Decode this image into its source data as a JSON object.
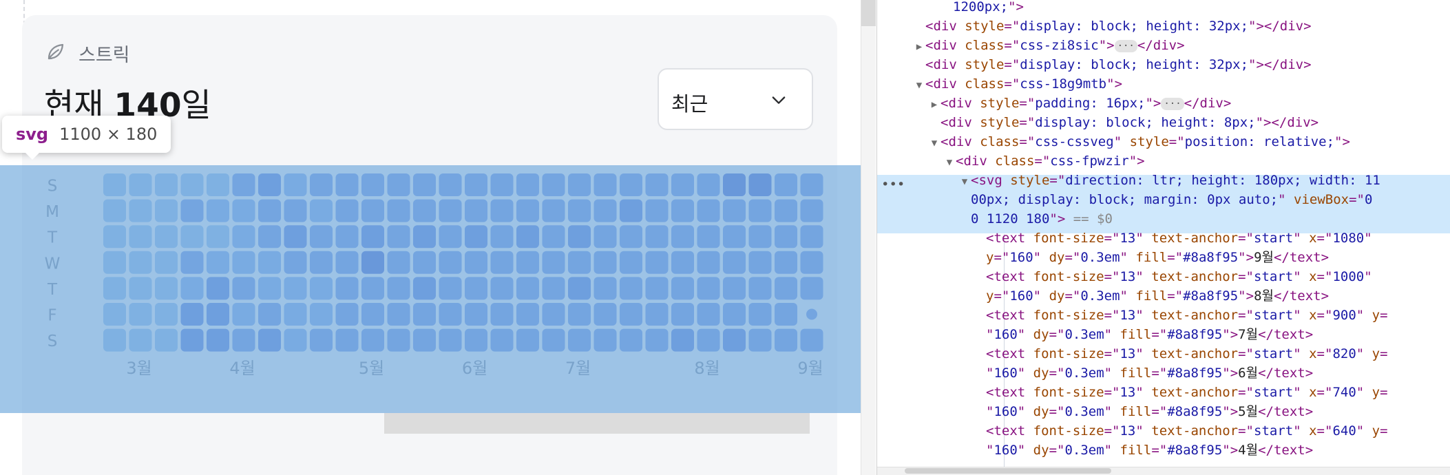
{
  "card": {
    "label": "스트릭",
    "current_prefix": "현재 ",
    "current_value": "140",
    "current_suffix": "일",
    "period_select": "최근"
  },
  "inspector_tooltip": {
    "tag": "svg",
    "size": "1100 × 180"
  },
  "heatmap": {
    "day_labels": [
      "S",
      "M",
      "T",
      "W",
      "T",
      "F",
      "S"
    ],
    "month_labels": [
      "3월",
      "4월",
      "5월",
      "6월",
      "7월",
      "8월",
      "9월"
    ],
    "month_columns": [
      1,
      5,
      10,
      14,
      18,
      23,
      27
    ],
    "colors": [
      "#9ec0ec",
      "#8dafed",
      "#7f9fe8",
      "#6e8de2",
      "#5e79d7"
    ],
    "levels": [
      [
        0,
        0,
        0,
        0,
        0,
        2,
        3,
        1,
        2,
        2,
        2,
        2,
        2,
        2,
        2,
        2,
        2,
        2,
        2,
        2,
        2,
        2,
        2,
        2,
        4,
        4,
        2,
        2
      ],
      [
        0,
        0,
        0,
        2,
        1,
        1,
        2,
        2,
        1,
        2,
        2,
        2,
        2,
        2,
        2,
        2,
        2,
        2,
        2,
        2,
        3,
        2,
        2,
        2,
        2,
        2,
        2,
        2
      ],
      [
        0,
        0,
        0,
        0,
        0,
        1,
        2,
        3,
        2,
        2,
        3,
        2,
        3,
        2,
        3,
        2,
        3,
        2,
        3,
        2,
        2,
        2,
        2,
        2,
        2,
        2,
        2,
        2
      ],
      [
        0,
        0,
        0,
        2,
        1,
        1,
        1,
        2,
        2,
        2,
        4,
        2,
        2,
        2,
        2,
        2,
        2,
        2,
        2,
        2,
        2,
        2,
        2,
        2,
        2,
        2,
        2,
        2
      ],
      [
        0,
        0,
        0,
        1,
        3,
        2,
        1,
        1,
        1,
        2,
        2,
        2,
        3,
        2,
        2,
        2,
        2,
        2,
        3,
        2,
        2,
        2,
        2,
        2,
        2,
        2,
        2,
        2
      ],
      [
        0,
        0,
        0,
        3,
        3,
        1,
        2,
        1,
        1,
        2,
        2,
        2,
        2,
        2,
        2,
        2,
        2,
        2,
        2,
        2,
        2,
        2,
        2,
        2,
        2,
        2,
        2,
        -1
      ],
      [
        0,
        0,
        0,
        3,
        3,
        2,
        3,
        1,
        2,
        2,
        2,
        2,
        2,
        2,
        2,
        2,
        2,
        2,
        2,
        2,
        2,
        2,
        3,
        2,
        3,
        2,
        2,
        2
      ]
    ]
  },
  "devtools": {
    "lines": [
      {
        "indent": 0,
        "tw": "",
        "parts": [
          [
            "val",
            "1200px;"
          ],
          [
            "tag",
            "\">"
          ]
        ]
      },
      {
        "indent": 0,
        "tw": "",
        "parts": [
          [
            "tag",
            "<div "
          ],
          [
            "attr",
            "style"
          ],
          [
            "tag",
            "=\""
          ],
          [
            "val",
            "display: block; height: 32px;"
          ],
          [
            "tag",
            "\"></div>"
          ]
        ]
      },
      {
        "indent": 0,
        "tw": "▶",
        "parts": [
          [
            "tag",
            "<div "
          ],
          [
            "attr",
            "class"
          ],
          [
            "tag",
            "=\""
          ],
          [
            "val",
            "css-zi8sic"
          ],
          [
            "tag",
            "\">"
          ],
          [
            "badge",
            "···"
          ],
          [
            "tag",
            "</div>"
          ]
        ]
      },
      {
        "indent": 0,
        "tw": "",
        "parts": [
          [
            "tag",
            "<div "
          ],
          [
            "attr",
            "style"
          ],
          [
            "tag",
            "=\""
          ],
          [
            "val",
            "display: block; height: 32px;"
          ],
          [
            "tag",
            "\"></div>"
          ]
        ]
      },
      {
        "indent": 0,
        "tw": "▼",
        "parts": [
          [
            "tag",
            "<div "
          ],
          [
            "attr",
            "class"
          ],
          [
            "tag",
            "=\""
          ],
          [
            "val",
            "css-18g9mtb"
          ],
          [
            "tag",
            "\">"
          ]
        ]
      },
      {
        "indent": 1,
        "tw": "▶",
        "parts": [
          [
            "tag",
            "<div "
          ],
          [
            "attr",
            "style"
          ],
          [
            "tag",
            "=\""
          ],
          [
            "val",
            "padding: 16px;"
          ],
          [
            "tag",
            "\">"
          ],
          [
            "badge",
            "···"
          ],
          [
            "tag",
            "</div>"
          ]
        ]
      },
      {
        "indent": 1,
        "tw": "",
        "parts": [
          [
            "tag",
            "<div "
          ],
          [
            "attr",
            "style"
          ],
          [
            "tag",
            "=\""
          ],
          [
            "val",
            "display: block; height: 8px;"
          ],
          [
            "tag",
            "\"></div>"
          ]
        ]
      },
      {
        "indent": 1,
        "tw": "▼",
        "parts": [
          [
            "tag",
            "<div "
          ],
          [
            "attr",
            "class"
          ],
          [
            "tag",
            "=\""
          ],
          [
            "val",
            "css-cssveg"
          ],
          [
            "tag",
            "\" "
          ],
          [
            "attr",
            "style"
          ],
          [
            "tag",
            "=\""
          ],
          [
            "val",
            "position: relative;"
          ],
          [
            "tag",
            "\">"
          ]
        ]
      },
      {
        "indent": 2,
        "tw": "▼",
        "parts": [
          [
            "tag",
            "<div "
          ],
          [
            "attr",
            "class"
          ],
          [
            "tag",
            "=\""
          ],
          [
            "val",
            "css-fpwzir"
          ],
          [
            "tag",
            "\">"
          ]
        ]
      },
      {
        "indent": 3,
        "tw": "▼",
        "sel": true,
        "parts": [
          [
            "tag",
            "<svg "
          ],
          [
            "attr",
            "style"
          ],
          [
            "tag",
            "=\""
          ],
          [
            "val",
            "direction: ltr; height: 180px; width: 11"
          ]
        ]
      },
      {
        "indent": 3,
        "tw": "",
        "sel": true,
        "parts": [
          [
            "val",
            "00px; display: block; margin: 0px auto;"
          ],
          [
            "tag",
            "\" "
          ],
          [
            "attr",
            "viewBox"
          ],
          [
            "tag",
            "=\""
          ],
          [
            "val",
            "0"
          ]
        ]
      },
      {
        "indent": 3,
        "tw": "",
        "sel": true,
        "parts": [
          [
            "val",
            "0 1120 180"
          ],
          [
            "tag",
            "\">"
          ],
          [
            "dim",
            " == $0"
          ]
        ]
      },
      {
        "indent": 4,
        "tw": "",
        "parts": [
          [
            "tag",
            "<text "
          ],
          [
            "attr",
            "font-size"
          ],
          [
            "tag",
            "=\""
          ],
          [
            "val",
            "13"
          ],
          [
            "tag",
            "\" "
          ],
          [
            "attr",
            "text-anchor"
          ],
          [
            "tag",
            "=\""
          ],
          [
            "val",
            "start"
          ],
          [
            "tag",
            "\" "
          ],
          [
            "attr",
            "x"
          ],
          [
            "tag",
            "=\""
          ],
          [
            "val",
            "1080"
          ],
          [
            "tag",
            "\""
          ]
        ]
      },
      {
        "indent": 4,
        "tw": "",
        "parts": [
          [
            "attr",
            "y"
          ],
          [
            "tag",
            "=\""
          ],
          [
            "val",
            "160"
          ],
          [
            "tag",
            "\" "
          ],
          [
            "attr",
            "dy"
          ],
          [
            "tag",
            "=\""
          ],
          [
            "val",
            "0.3em"
          ],
          [
            "tag",
            "\" "
          ],
          [
            "attr",
            "fill"
          ],
          [
            "tag",
            "=\""
          ],
          [
            "val",
            "#8a8f95"
          ],
          [
            "tag",
            "\">"
          ],
          [
            "txt",
            "9월"
          ],
          [
            "tag",
            "</text>"
          ]
        ]
      },
      {
        "indent": 4,
        "tw": "",
        "parts": [
          [
            "tag",
            "<text "
          ],
          [
            "attr",
            "font-size"
          ],
          [
            "tag",
            "=\""
          ],
          [
            "val",
            "13"
          ],
          [
            "tag",
            "\" "
          ],
          [
            "attr",
            "text-anchor"
          ],
          [
            "tag",
            "=\""
          ],
          [
            "val",
            "start"
          ],
          [
            "tag",
            "\" "
          ],
          [
            "attr",
            "x"
          ],
          [
            "tag",
            "=\""
          ],
          [
            "val",
            "1000"
          ],
          [
            "tag",
            "\""
          ]
        ]
      },
      {
        "indent": 4,
        "tw": "",
        "parts": [
          [
            "attr",
            "y"
          ],
          [
            "tag",
            "=\""
          ],
          [
            "val",
            "160"
          ],
          [
            "tag",
            "\" "
          ],
          [
            "attr",
            "dy"
          ],
          [
            "tag",
            "=\""
          ],
          [
            "val",
            "0.3em"
          ],
          [
            "tag",
            "\" "
          ],
          [
            "attr",
            "fill"
          ],
          [
            "tag",
            "=\""
          ],
          [
            "val",
            "#8a8f95"
          ],
          [
            "tag",
            "\">"
          ],
          [
            "txt",
            "8월"
          ],
          [
            "tag",
            "</text>"
          ]
        ]
      },
      {
        "indent": 4,
        "tw": "",
        "parts": [
          [
            "tag",
            "<text "
          ],
          [
            "attr",
            "font-size"
          ],
          [
            "tag",
            "=\""
          ],
          [
            "val",
            "13"
          ],
          [
            "tag",
            "\" "
          ],
          [
            "attr",
            "text-anchor"
          ],
          [
            "tag",
            "=\""
          ],
          [
            "val",
            "start"
          ],
          [
            "tag",
            "\" "
          ],
          [
            "attr",
            "x"
          ],
          [
            "tag",
            "=\""
          ],
          [
            "val",
            "900"
          ],
          [
            "tag",
            "\" "
          ],
          [
            "attr",
            "y"
          ],
          [
            "tag",
            "="
          ]
        ]
      },
      {
        "indent": 4,
        "tw": "",
        "parts": [
          [
            "tag",
            "\""
          ],
          [
            "val",
            "160"
          ],
          [
            "tag",
            "\" "
          ],
          [
            "attr",
            "dy"
          ],
          [
            "tag",
            "=\""
          ],
          [
            "val",
            "0.3em"
          ],
          [
            "tag",
            "\" "
          ],
          [
            "attr",
            "fill"
          ],
          [
            "tag",
            "=\""
          ],
          [
            "val",
            "#8a8f95"
          ],
          [
            "tag",
            "\">"
          ],
          [
            "txt",
            "7월"
          ],
          [
            "tag",
            "</text>"
          ]
        ]
      },
      {
        "indent": 4,
        "tw": "",
        "parts": [
          [
            "tag",
            "<text "
          ],
          [
            "attr",
            "font-size"
          ],
          [
            "tag",
            "=\""
          ],
          [
            "val",
            "13"
          ],
          [
            "tag",
            "\" "
          ],
          [
            "attr",
            "text-anchor"
          ],
          [
            "tag",
            "=\""
          ],
          [
            "val",
            "start"
          ],
          [
            "tag",
            "\" "
          ],
          [
            "attr",
            "x"
          ],
          [
            "tag",
            "=\""
          ],
          [
            "val",
            "820"
          ],
          [
            "tag",
            "\" "
          ],
          [
            "attr",
            "y"
          ],
          [
            "tag",
            "="
          ]
        ]
      },
      {
        "indent": 4,
        "tw": "",
        "parts": [
          [
            "tag",
            "\""
          ],
          [
            "val",
            "160"
          ],
          [
            "tag",
            "\" "
          ],
          [
            "attr",
            "dy"
          ],
          [
            "tag",
            "=\""
          ],
          [
            "val",
            "0.3em"
          ],
          [
            "tag",
            "\" "
          ],
          [
            "attr",
            "fill"
          ],
          [
            "tag",
            "=\""
          ],
          [
            "val",
            "#8a8f95"
          ],
          [
            "tag",
            "\">"
          ],
          [
            "txt",
            "6월"
          ],
          [
            "tag",
            "</text>"
          ]
        ]
      },
      {
        "indent": 4,
        "tw": "",
        "parts": [
          [
            "tag",
            "<text "
          ],
          [
            "attr",
            "font-size"
          ],
          [
            "tag",
            "=\""
          ],
          [
            "val",
            "13"
          ],
          [
            "tag",
            "\" "
          ],
          [
            "attr",
            "text-anchor"
          ],
          [
            "tag",
            "=\""
          ],
          [
            "val",
            "start"
          ],
          [
            "tag",
            "\" "
          ],
          [
            "attr",
            "x"
          ],
          [
            "tag",
            "=\""
          ],
          [
            "val",
            "740"
          ],
          [
            "tag",
            "\" "
          ],
          [
            "attr",
            "y"
          ],
          [
            "tag",
            "="
          ]
        ]
      },
      {
        "indent": 4,
        "tw": "",
        "parts": [
          [
            "tag",
            "\""
          ],
          [
            "val",
            "160"
          ],
          [
            "tag",
            "\" "
          ],
          [
            "attr",
            "dy"
          ],
          [
            "tag",
            "=\""
          ],
          [
            "val",
            "0.3em"
          ],
          [
            "tag",
            "\" "
          ],
          [
            "attr",
            "fill"
          ],
          [
            "tag",
            "=\""
          ],
          [
            "val",
            "#8a8f95"
          ],
          [
            "tag",
            "\">"
          ],
          [
            "txt",
            "5월"
          ],
          [
            "tag",
            "</text>"
          ]
        ]
      },
      {
        "indent": 4,
        "tw": "",
        "parts": [
          [
            "tag",
            "<text "
          ],
          [
            "attr",
            "font-size"
          ],
          [
            "tag",
            "=\""
          ],
          [
            "val",
            "13"
          ],
          [
            "tag",
            "\" "
          ],
          [
            "attr",
            "text-anchor"
          ],
          [
            "tag",
            "=\""
          ],
          [
            "val",
            "start"
          ],
          [
            "tag",
            "\" "
          ],
          [
            "attr",
            "x"
          ],
          [
            "tag",
            "=\""
          ],
          [
            "val",
            "640"
          ],
          [
            "tag",
            "\" "
          ],
          [
            "attr",
            "y"
          ],
          [
            "tag",
            "="
          ]
        ]
      },
      {
        "indent": 4,
        "tw": "",
        "parts": [
          [
            "tag",
            "\""
          ],
          [
            "val",
            "160"
          ],
          [
            "tag",
            "\" "
          ],
          [
            "attr",
            "dy"
          ],
          [
            "tag",
            "=\""
          ],
          [
            "val",
            "0.3em"
          ],
          [
            "tag",
            "\" "
          ],
          [
            "attr",
            "fill"
          ],
          [
            "tag",
            "=\""
          ],
          [
            "val",
            "#8a8f95"
          ],
          [
            "tag",
            "\">"
          ],
          [
            "txt",
            "4월"
          ],
          [
            "tag",
            "</text>"
          ]
        ]
      }
    ]
  }
}
